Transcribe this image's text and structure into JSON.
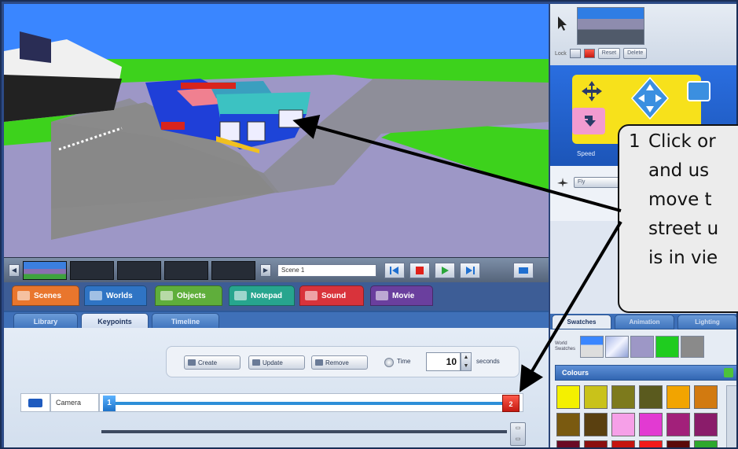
{
  "filmstrip": {
    "scene_name": "Scene 1"
  },
  "main_tabs": [
    {
      "label": "Scenes",
      "color": "#e9762d"
    },
    {
      "label": "Worlds",
      "color": "#2f74c4"
    },
    {
      "label": "Objects",
      "color": "#5fae3b"
    },
    {
      "label": "Notepad",
      "color": "#27a58e"
    },
    {
      "label": "Sound",
      "color": "#d9333b"
    },
    {
      "label": "Movie",
      "color": "#6a3f9e"
    }
  ],
  "sub_tabs": [
    "Library",
    "Keypoints",
    "Timeline"
  ],
  "keypoints": {
    "create_label": "Create",
    "update_label": "Update",
    "remove_label": "Remove",
    "time_label": "Time",
    "time_value": "10",
    "time_unit": "seconds",
    "camera_label": "Camera",
    "start_key": "1",
    "end_key": "2"
  },
  "right_panel": {
    "lock_label": "Lock",
    "reset_label": "Reset",
    "delete_label": "Delete",
    "speed_label": "Speed",
    "fly_label": "Fly",
    "tabs": [
      "Swatches",
      "Animation",
      "Lighting"
    ],
    "world_swatches_label": "World Swatches",
    "colours_label": "Colours",
    "palette": [
      "#f4f000",
      "#c9c21a",
      "#7d7a1c",
      "#5a5a1e",
      "#f2a400",
      "#d27a10",
      "#7a5a10",
      "#5a4010",
      "#f6a0e8",
      "#e23ad2",
      "#a2207a",
      "#8a1c6a",
      "#6a0a24",
      "#8a0f0f",
      "#c4140f",
      "#f21a1a",
      "#5a0a0a",
      "#2ea82e"
    ]
  },
  "callout": {
    "number": "1",
    "lines": [
      "Click or",
      "and us",
      "move t",
      "street u",
      "is in vie"
    ]
  }
}
